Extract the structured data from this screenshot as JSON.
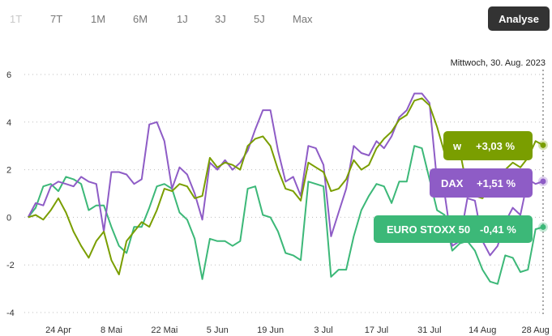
{
  "range_tabs": [
    {
      "label": "1T",
      "disabled": true
    },
    {
      "label": "7T",
      "disabled": false
    },
    {
      "label": "1M",
      "disabled": false
    },
    {
      "label": "6M",
      "disabled": false
    },
    {
      "label": "1J",
      "disabled": false
    },
    {
      "label": "3J",
      "disabled": false
    },
    {
      "label": "5J",
      "disabled": false
    },
    {
      "label": "Max",
      "disabled": false
    }
  ],
  "analyse_label": "Analyse",
  "date_label": "Mittwoch, 30. Aug. 2023",
  "chart_data": {
    "type": "line",
    "x_tick_labels": [
      "24 Apr",
      "8 Mai",
      "22 Mai",
      "5 Jun",
      "19 Jun",
      "3 Jul",
      "17 Jul",
      "31 Jul",
      "14 Aug",
      "28 Aug"
    ],
    "x_tick_days": [
      8,
      22,
      36,
      50,
      64,
      78,
      92,
      106,
      120,
      134
    ],
    "x_range_days": [
      -1,
      136
    ],
    "y_ticks": [
      -4,
      -2,
      0,
      2,
      4,
      6
    ],
    "ylim": [
      -4,
      6
    ],
    "grid": true,
    "series": [
      {
        "name": "DAX",
        "color": "#8e5cc6",
        "change_label": "+1,51 %",
        "points": [
          [
            0,
            0
          ],
          [
            2,
            0.6
          ],
          [
            4,
            0.5
          ],
          [
            6,
            1.3
          ],
          [
            8,
            1.5
          ],
          [
            10,
            1.4
          ],
          [
            12,
            1.3
          ],
          [
            14,
            1.7
          ],
          [
            16,
            1.5
          ],
          [
            18,
            1.4
          ],
          [
            20,
            -0.6
          ],
          [
            22,
            1.9
          ],
          [
            24,
            1.9
          ],
          [
            26,
            1.8
          ],
          [
            28,
            1.4
          ],
          [
            30,
            1.6
          ],
          [
            32,
            3.9
          ],
          [
            34,
            4.0
          ],
          [
            36,
            3.2
          ],
          [
            38,
            1.2
          ],
          [
            40,
            2.1
          ],
          [
            42,
            1.8
          ],
          [
            44,
            1.0
          ],
          [
            46,
            -0.1
          ],
          [
            48,
            2.3
          ],
          [
            50,
            2.0
          ],
          [
            52,
            2.4
          ],
          [
            54,
            2.0
          ],
          [
            56,
            2.3
          ],
          [
            58,
            2.8
          ],
          [
            60,
            3.7
          ],
          [
            62,
            4.5
          ],
          [
            64,
            4.5
          ],
          [
            66,
            2.8
          ],
          [
            68,
            1.5
          ],
          [
            70,
            1.7
          ],
          [
            72,
            0.9
          ],
          [
            74,
            3.0
          ],
          [
            76,
            2.9
          ],
          [
            78,
            2.2
          ],
          [
            80,
            -0.8
          ],
          [
            82,
            0.2
          ],
          [
            84,
            1.2
          ],
          [
            86,
            3.0
          ],
          [
            88,
            2.7
          ],
          [
            90,
            2.6
          ],
          [
            92,
            3.2
          ],
          [
            94,
            2.9
          ],
          [
            96,
            3.4
          ],
          [
            98,
            4.2
          ],
          [
            100,
            4.5
          ],
          [
            102,
            5.2
          ],
          [
            104,
            5.2
          ],
          [
            106,
            4.8
          ],
          [
            108,
            1.5
          ],
          [
            110,
            1.0
          ],
          [
            112,
            -1.2
          ],
          [
            114,
            -1.0
          ],
          [
            116,
            0.8
          ],
          [
            118,
            0.7
          ],
          [
            120,
            -1.0
          ],
          [
            122,
            -1.6
          ],
          [
            124,
            -1.2
          ],
          [
            126,
            -0.2
          ],
          [
            128,
            0.4
          ],
          [
            130,
            0.1
          ],
          [
            132,
            1.6
          ],
          [
            134,
            1.4
          ],
          [
            136,
            1.51
          ]
        ]
      },
      {
        "name": "w",
        "color": "#7a9e00",
        "change_label": "+3,03 %",
        "points": [
          [
            0,
            0
          ],
          [
            2,
            0.1
          ],
          [
            4,
            -0.1
          ],
          [
            6,
            0.3
          ],
          [
            8,
            0.8
          ],
          [
            10,
            0.2
          ],
          [
            12,
            -0.6
          ],
          [
            14,
            -1.2
          ],
          [
            16,
            -1.7
          ],
          [
            18,
            -1.0
          ],
          [
            20,
            -0.6
          ],
          [
            22,
            -1.8
          ],
          [
            24,
            -2.4
          ],
          [
            26,
            -1.0
          ],
          [
            28,
            -0.6
          ],
          [
            30,
            -0.2
          ],
          [
            32,
            -0.4
          ],
          [
            34,
            0.3
          ],
          [
            36,
            1.2
          ],
          [
            38,
            1.1
          ],
          [
            40,
            1.4
          ],
          [
            42,
            1.3
          ],
          [
            44,
            0.8
          ],
          [
            46,
            0.9
          ],
          [
            48,
            2.5
          ],
          [
            50,
            2.1
          ],
          [
            52,
            2.3
          ],
          [
            54,
            2.2
          ],
          [
            56,
            2.0
          ],
          [
            58,
            3.0
          ],
          [
            60,
            3.3
          ],
          [
            62,
            3.4
          ],
          [
            64,
            3.0
          ],
          [
            66,
            2.0
          ],
          [
            68,
            1.2
          ],
          [
            70,
            1.1
          ],
          [
            72,
            0.7
          ],
          [
            74,
            2.3
          ],
          [
            76,
            2.1
          ],
          [
            78,
            1.9
          ],
          [
            80,
            1.1
          ],
          [
            82,
            1.2
          ],
          [
            84,
            1.6
          ],
          [
            86,
            2.4
          ],
          [
            88,
            2.0
          ],
          [
            90,
            2.2
          ],
          [
            92,
            2.9
          ],
          [
            94,
            3.3
          ],
          [
            96,
            3.6
          ],
          [
            98,
            4.1
          ],
          [
            100,
            4.3
          ],
          [
            102,
            4.9
          ],
          [
            104,
            5.0
          ],
          [
            106,
            4.7
          ],
          [
            108,
            3.8
          ],
          [
            110,
            2.7
          ],
          [
            112,
            2.9
          ],
          [
            114,
            2.8
          ],
          [
            116,
            1.2
          ],
          [
            118,
            0.9
          ],
          [
            120,
            0.8
          ],
          [
            122,
            1.3
          ],
          [
            124,
            1.8
          ],
          [
            126,
            2.0
          ],
          [
            128,
            2.3
          ],
          [
            130,
            2.1
          ],
          [
            132,
            2.5
          ],
          [
            134,
            3.2
          ],
          [
            136,
            3.03
          ]
        ]
      },
      {
        "name": "EURO STOXX 50",
        "color": "#3cb878",
        "change_label": "-0,41 %",
        "points": [
          [
            0,
            0
          ],
          [
            2,
            0.4
          ],
          [
            4,
            1.3
          ],
          [
            6,
            1.4
          ],
          [
            8,
            1.1
          ],
          [
            10,
            1.7
          ],
          [
            12,
            1.6
          ],
          [
            14,
            1.4
          ],
          [
            16,
            0.3
          ],
          [
            18,
            0.5
          ],
          [
            20,
            0.5
          ],
          [
            22,
            -0.4
          ],
          [
            24,
            -1.2
          ],
          [
            26,
            -1.5
          ],
          [
            28,
            -0.4
          ],
          [
            30,
            -0.4
          ],
          [
            32,
            0.4
          ],
          [
            34,
            1.3
          ],
          [
            36,
            1.4
          ],
          [
            38,
            1.2
          ],
          [
            40,
            0.2
          ],
          [
            42,
            -0.1
          ],
          [
            44,
            -0.9
          ],
          [
            46,
            -2.6
          ],
          [
            48,
            -0.9
          ],
          [
            50,
            -1.0
          ],
          [
            52,
            -1.0
          ],
          [
            54,
            -1.2
          ],
          [
            56,
            -1.0
          ],
          [
            58,
            1.2
          ],
          [
            60,
            1.3
          ],
          [
            62,
            0.1
          ],
          [
            64,
            0.0
          ],
          [
            66,
            -0.6
          ],
          [
            68,
            -1.5
          ],
          [
            70,
            -1.6
          ],
          [
            72,
            -1.8
          ],
          [
            74,
            1.5
          ],
          [
            76,
            1.4
          ],
          [
            78,
            1.3
          ],
          [
            80,
            -2.5
          ],
          [
            82,
            -2.2
          ],
          [
            84,
            -2.2
          ],
          [
            86,
            -0.8
          ],
          [
            88,
            0.3
          ],
          [
            90,
            0.9
          ],
          [
            92,
            1.4
          ],
          [
            94,
            1.3
          ],
          [
            96,
            0.6
          ],
          [
            98,
            1.5
          ],
          [
            100,
            1.5
          ],
          [
            102,
            3.0
          ],
          [
            104,
            2.9
          ],
          [
            106,
            1.6
          ],
          [
            108,
            0.3
          ],
          [
            110,
            0.1
          ],
          [
            112,
            -1.4
          ],
          [
            114,
            -1.1
          ],
          [
            116,
            -1.0
          ],
          [
            118,
            -1.4
          ],
          [
            120,
            -2.2
          ],
          [
            122,
            -2.7
          ],
          [
            124,
            -2.8
          ],
          [
            126,
            -1.6
          ],
          [
            128,
            -1.7
          ],
          [
            130,
            -2.3
          ],
          [
            132,
            -2.2
          ],
          [
            134,
            -0.5
          ],
          [
            136,
            -0.41
          ]
        ]
      }
    ],
    "legend_placement": "right"
  }
}
